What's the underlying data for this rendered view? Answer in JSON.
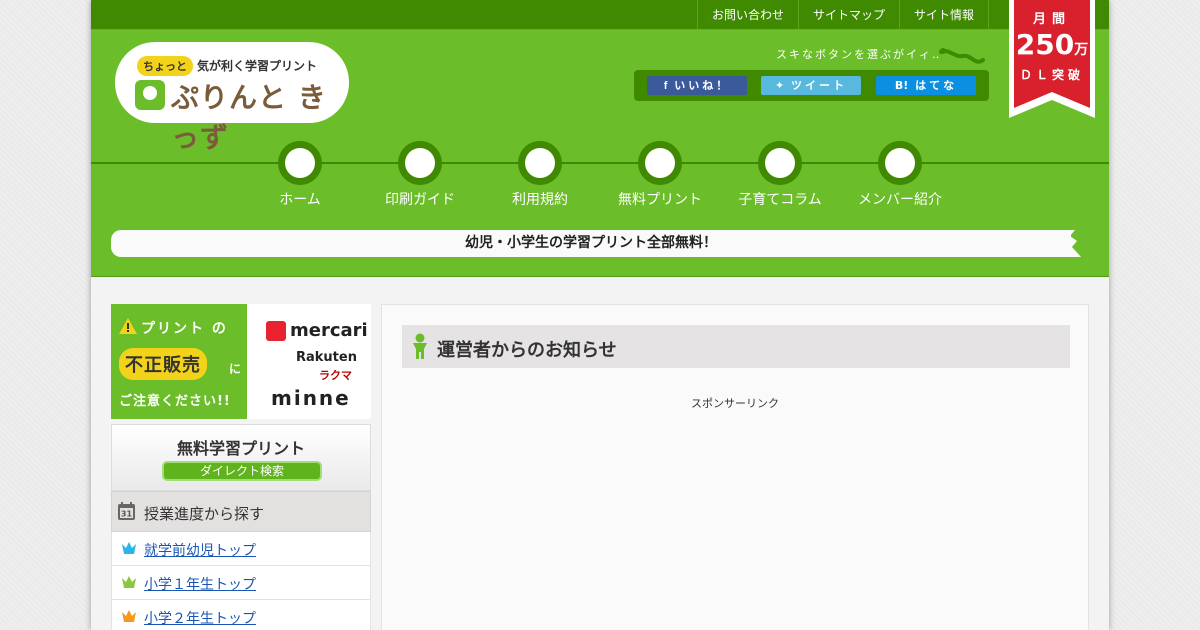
{
  "topnav": [
    "お問い合わせ",
    "サイトマップ",
    "サイト情報"
  ],
  "logo": {
    "tagline_tag": "ちょっと",
    "tagline": "気が利く学習プリント",
    "name": "ぷりんと きっず"
  },
  "share": {
    "caption": "スキなボタンを選ぶがイィ‥",
    "facebook": "いいね！",
    "twitter": "ツイート",
    "hatena": "はてな"
  },
  "ribbon": {
    "line1": "月間",
    "count": "250",
    "unit": "万",
    "line3": "ＤＬ突破"
  },
  "nav": [
    "ホーム",
    "印刷ガイド",
    "利用規約",
    "無料プリント",
    "子育てコラム",
    "メンバー紹介"
  ],
  "banner": "幼児・小学生の学習プリント全部無料！",
  "promo": {
    "line1": "プリント の",
    "highlight": "不正販売",
    "suffix": "に",
    "line3": "ご注意ください!!",
    "brands": [
      "mercari",
      "Rakuten",
      "ラクマ",
      "minne"
    ]
  },
  "sidebar": {
    "search_title": "無料学習プリント",
    "search_button": "ダイレクト検索",
    "section_title": "授業進度から探す",
    "calendar_day": "31",
    "links": [
      "就学前幼児トップ",
      "小学１年生トップ",
      "小学２年生トップ"
    ]
  },
  "content": {
    "title": "運営者からのお知らせ",
    "sponsor": "スポンサーリンク"
  },
  "colors": {
    "header_green": "#6bbd2a",
    "dark_green": "#3f8a00",
    "ribbon_red": "#d9212e",
    "link_blue": "#1a57b4",
    "crown_colors": [
      "#29b6e8",
      "#8cc63f",
      "#f39a1e"
    ]
  }
}
